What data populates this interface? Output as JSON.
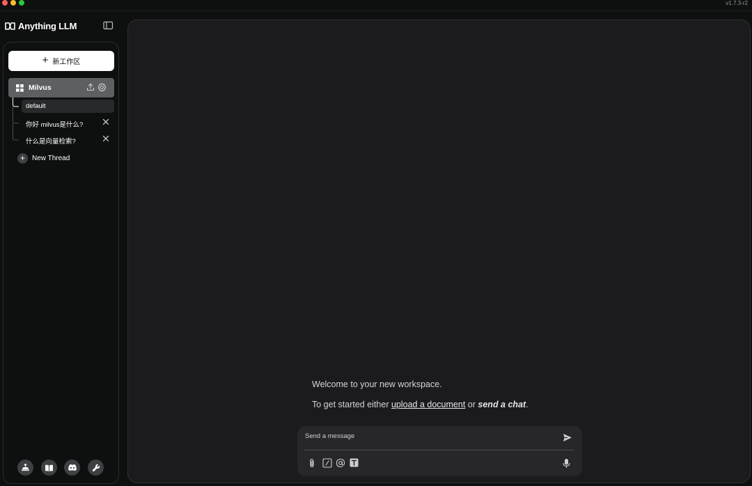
{
  "window": {
    "version": "v1.7.3-r2"
  },
  "brand": {
    "name": "Anything LLM"
  },
  "sidebar": {
    "new_workspace_label": "新工作区",
    "workspace": {
      "name": "Milvus"
    },
    "threads": [
      {
        "label": "default",
        "active": true,
        "closable": false
      },
      {
        "label": "你好 milvus是什么?",
        "active": false,
        "closable": true
      },
      {
        "label": "什么是向量检索?",
        "active": false,
        "closable": true
      }
    ],
    "new_thread_label": "New Thread",
    "footer_icons": [
      "community-hub-icon",
      "docs-book-icon",
      "discord-icon",
      "wrench-settings-icon"
    ]
  },
  "main": {
    "welcome_text": "Welcome to your new workspace.",
    "get_started_prefix": "To get started either",
    "upload_link": "upload a document",
    "or_text": "or",
    "send_chat_link": "send a chat",
    "period": "."
  },
  "composer": {
    "placeholder": "Send a message",
    "tool_icons": [
      "paperclip-icon",
      "slash-command-icon",
      "at-mention-icon",
      "text-size-icon",
      "microphone-icon"
    ]
  },
  "colors": {
    "background": "#0e0f0f",
    "main_panel": "#1b1b1e",
    "workspace_active": "#5d5f62",
    "thread_active": "#27292b",
    "composer": "#27272a"
  }
}
